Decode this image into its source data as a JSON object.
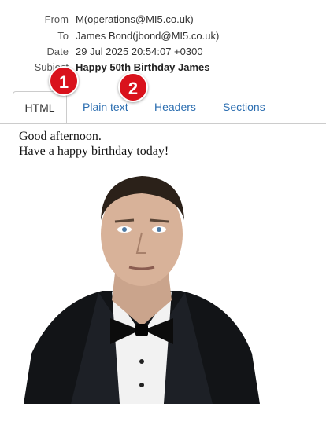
{
  "headers": {
    "from": {
      "label": "From",
      "value": "M(operations@MI5.co.uk)"
    },
    "to": {
      "label": "To",
      "value": "James Bond(jbond@MI5.co.uk)"
    },
    "date": {
      "label": "Date",
      "value": "29 Jul 2025 20:54:07 +0300"
    },
    "subject": {
      "label": "Subject",
      "value": "Happy 50th Birthday James"
    }
  },
  "tabs": [
    {
      "label": "HTML",
      "active": true
    },
    {
      "label": "Plain text",
      "active": false
    },
    {
      "label": "Headers",
      "active": false
    },
    {
      "label": "Sections",
      "active": false
    }
  ],
  "badges": [
    "1",
    "2"
  ],
  "message": {
    "line1": "Good afternoon.",
    "line2": "Have a happy birthday today!"
  },
  "colors": {
    "link": "#2a6db0",
    "badge": "#d9121c"
  }
}
